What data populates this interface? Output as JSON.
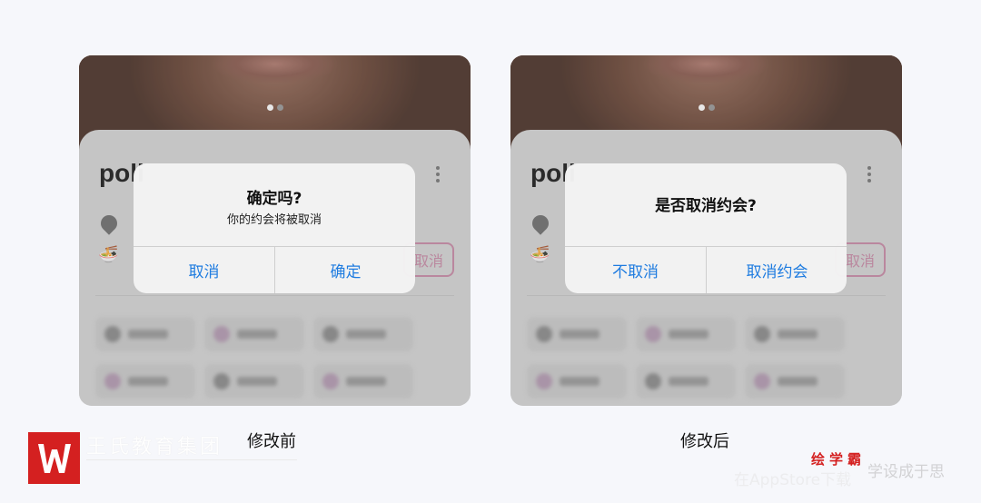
{
  "before": {
    "caption": "修改前",
    "profile_name": "poli",
    "cancel_pill": "取消",
    "dialog": {
      "title": "确定吗?",
      "message": "你的约会将被取消",
      "left_button": "取消",
      "right_button": "确定"
    }
  },
  "after": {
    "caption": "修改后",
    "profile_name": "poli",
    "cancel_pill": "取消",
    "dialog": {
      "title": "是否取消约会?",
      "left_button": "不取消",
      "right_button": "取消约会"
    }
  },
  "watermarks": {
    "org": "王氏教育集团",
    "right_red": "绘学霸",
    "right_tagline": "学设成于思",
    "right_store": "在AppStore下载"
  },
  "colors": {
    "accent_blue": "#1f7ce0",
    "brand_red": "#d42020",
    "pill_pink": "#c88aa6"
  }
}
